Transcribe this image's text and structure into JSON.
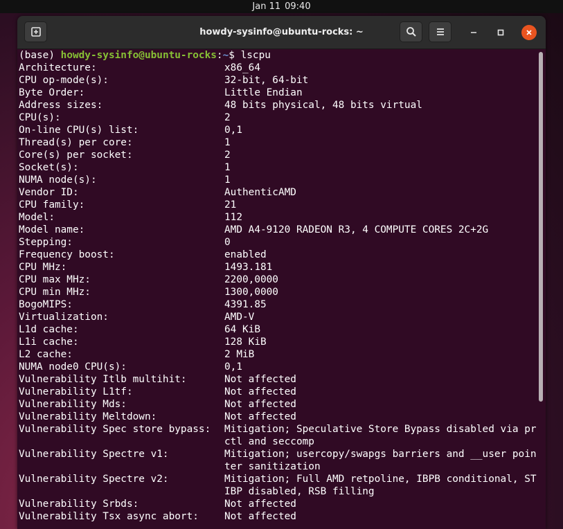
{
  "topbar": {
    "date": "Jan 11",
    "time": "09:40"
  },
  "window": {
    "title": "howdy-sysinfo@ubuntu-rocks: ~",
    "accent_close": "#e95420",
    "icons": [
      "new-tab-icon",
      "search-icon",
      "hamburger-menu-icon",
      "minimize-icon",
      "maximize-icon",
      "close-icon"
    ]
  },
  "terminal": {
    "background": "#300a24",
    "prompt": {
      "env": "(base) ",
      "user_host": "howdy-sysinfo@ubuntu-rocks",
      "sep": ":",
      "path": "~",
      "symbol": "$ ",
      "command": "lscpu"
    },
    "rows": [
      {
        "key": "Architecture:",
        "value": "x86_64"
      },
      {
        "key": "CPU op-mode(s):",
        "value": "32-bit, 64-bit"
      },
      {
        "key": "Byte Order:",
        "value": "Little Endian"
      },
      {
        "key": "Address sizes:",
        "value": "48 bits physical, 48 bits virtual"
      },
      {
        "key": "CPU(s):",
        "value": "2"
      },
      {
        "key": "On-line CPU(s) list:",
        "value": "0,1"
      },
      {
        "key": "Thread(s) per core:",
        "value": "1"
      },
      {
        "key": "Core(s) per socket:",
        "value": "2"
      },
      {
        "key": "Socket(s):",
        "value": "1"
      },
      {
        "key": "NUMA node(s):",
        "value": "1"
      },
      {
        "key": "Vendor ID:",
        "value": "AuthenticAMD"
      },
      {
        "key": "CPU family:",
        "value": "21"
      },
      {
        "key": "Model:",
        "value": "112"
      },
      {
        "key": "Model name:",
        "value": "AMD A4-9120 RADEON R3, 4 COMPUTE CORES 2C+2G"
      },
      {
        "key": "Stepping:",
        "value": "0"
      },
      {
        "key": "Frequency boost:",
        "value": "enabled"
      },
      {
        "key": "CPU MHz:",
        "value": "1493.181"
      },
      {
        "key": "CPU max MHz:",
        "value": "2200,0000"
      },
      {
        "key": "CPU min MHz:",
        "value": "1300,0000"
      },
      {
        "key": "BogoMIPS:",
        "value": "4391.85"
      },
      {
        "key": "Virtualization:",
        "value": "AMD-V"
      },
      {
        "key": "L1d cache:",
        "value": "64 KiB"
      },
      {
        "key": "L1i cache:",
        "value": "128 KiB"
      },
      {
        "key": "L2 cache:",
        "value": "2 MiB"
      },
      {
        "key": "NUMA node0 CPU(s):",
        "value": "0,1"
      },
      {
        "key": "Vulnerability Itlb multihit:",
        "value": "Not affected"
      },
      {
        "key": "Vulnerability L1tf:",
        "value": "Not affected"
      },
      {
        "key": "Vulnerability Mds:",
        "value": "Not affected"
      },
      {
        "key": "Vulnerability Meltdown:",
        "value": "Not affected"
      },
      {
        "key": "Vulnerability Spec store bypass:",
        "value": "Mitigation; Speculative Store Bypass disabled via prctl and seccomp"
      },
      {
        "key": "Vulnerability Spectre v1:",
        "value": "Mitigation; usercopy/swapgs barriers and __user pointer sanitization"
      },
      {
        "key": "Vulnerability Spectre v2:",
        "value": "Mitigation; Full AMD retpoline, IBPB conditional, STIBP disabled, RSB filling"
      },
      {
        "key": "Vulnerability Srbds:",
        "value": "Not affected"
      },
      {
        "key": "Vulnerability Tsx async abort:",
        "value": "Not affected"
      }
    ]
  }
}
